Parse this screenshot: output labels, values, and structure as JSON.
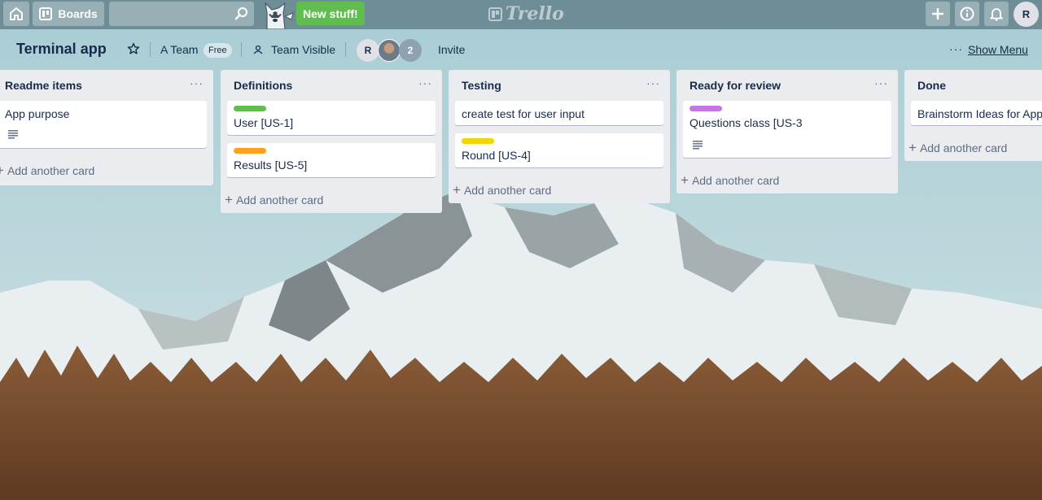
{
  "header": {
    "boards_label": "Boards",
    "search_value": "",
    "search_placeholder": "",
    "new_stuff_label": "New stuff!",
    "logo_text": "Trello",
    "user_initial": "R"
  },
  "board": {
    "title": "Terminal app",
    "team_name": "A Team",
    "plan_badge": "Free",
    "visibility": "Team Visible",
    "member_initial": "R",
    "extra_members": "2",
    "invite_label": "Invite",
    "menu_dots": "···",
    "show_menu_label": "Show Menu"
  },
  "lists": [
    {
      "title": "Readme items",
      "menu": "···",
      "cards": [
        {
          "text": "App purpose",
          "label_color": "",
          "has_description": true
        }
      ],
      "add_label": "Add another card"
    },
    {
      "title": "Definitions",
      "menu": "···",
      "cards": [
        {
          "text": "User [US-1]",
          "label_color": "#61bd4f",
          "has_description": false
        },
        {
          "text": "Results [US-5]",
          "label_color": "#ff9f1a",
          "has_description": false
        }
      ],
      "add_label": "Add another card"
    },
    {
      "title": "Testing",
      "menu": "···",
      "cards": [
        {
          "text": "create test for user input",
          "label_color": "",
          "has_description": false
        },
        {
          "text": "Round [US-4]",
          "label_color": "#f2d600",
          "has_description": false
        }
      ],
      "add_label": "Add another card"
    },
    {
      "title": "Ready for review",
      "menu": "···",
      "cards": [
        {
          "text": "Questions class [US-3",
          "label_color": "#c377e0",
          "has_description": true
        }
      ],
      "add_label": "Add another card"
    },
    {
      "title": "Done",
      "menu": "",
      "cards": [
        {
          "text": "Brainstorm Ideas for App",
          "label_color": "",
          "has_description": false
        }
      ],
      "add_label": "Add another card"
    }
  ],
  "icons": {
    "home": "home-icon",
    "boards": "boards-icon",
    "search": "search-icon",
    "mascot": "husky-mascot-icon",
    "add": "plus-icon",
    "info": "info-icon",
    "notifications": "bell-icon",
    "star": "star-icon",
    "visibility": "team-visibility-icon",
    "description": "description-icon"
  },
  "colors": {
    "new_stuff": "#61bd4f",
    "label_green": "#61bd4f",
    "label_orange": "#ff9f1a",
    "label_yellow": "#f2d600",
    "label_purple": "#c377e0"
  }
}
